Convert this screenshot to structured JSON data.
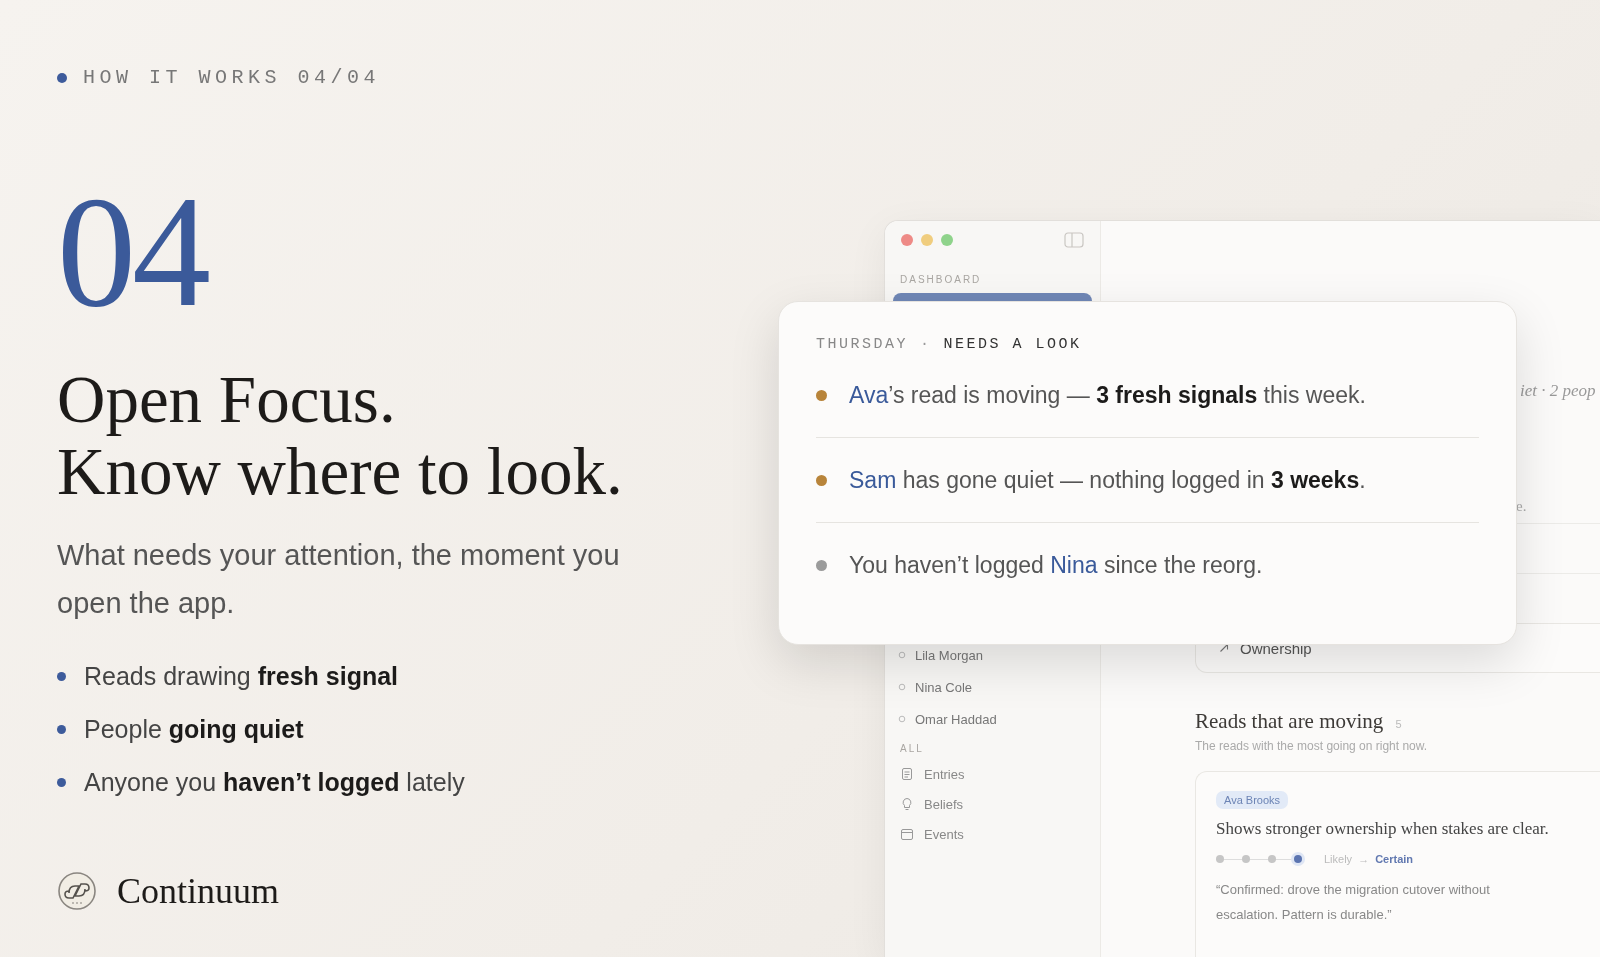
{
  "eyebrow": "HOW IT WORKS 04/04",
  "step_number": "04",
  "headline": [
    "Open Focus.",
    "Know where to look."
  ],
  "subtitle": "What needs your attention, the moment you open the app.",
  "bullets": [
    "Reads drawing **fresh signal**",
    "People **going quiet**",
    "Anyone you **haven’t logged** lately"
  ],
  "brand": "Continuum",
  "app_window": {
    "sidebar": {
      "section_label": "DASHBOARD",
      "people": [
        "Lila Morgan",
        "Nina Cole",
        "Omar Haddad"
      ],
      "all_label": "ALL",
      "links": [
        {
          "kind": "entries",
          "label": "Entries"
        },
        {
          "kind": "beliefs",
          "label": "Beliefs"
        },
        {
          "kind": "events",
          "label": "Events"
        }
      ]
    },
    "main": {
      "partial_caption": "iet · 2 peop",
      "partial_text": "e.",
      "ownership_card": "Ownership",
      "section_title": "Reads that are moving",
      "section_count": "5",
      "section_subtitle": "The reads with the most going on right now.",
      "read_card": {
        "tag": "Ava Brooks",
        "statement": "Shows stronger ownership when stakes are clear.",
        "steps": [
          {
            "selected": false
          },
          {
            "selected": false
          },
          {
            "selected": false
          },
          {
            "selected": true
          }
        ],
        "from_label": "Likely",
        "arrow": "→",
        "to_label": "Certain",
        "quote": "“Confirmed: drove the migration cutover without escalation. Pattern is durable.”"
      }
    }
  },
  "popup": {
    "day": "THURSDAY",
    "separator": "·",
    "heading": "NEEDS A LOOK",
    "items": [
      {
        "color": "#b8843a",
        "segments": [
          {
            "kind": "name",
            "text": "Ava"
          },
          {
            "kind": "plain",
            "text": "’s read is moving — "
          },
          {
            "kind": "strong",
            "text": "3 fresh signals"
          },
          {
            "kind": "plain",
            "text": " this week."
          }
        ]
      },
      {
        "color": "#b8843a",
        "segments": [
          {
            "kind": "name",
            "text": "Sam"
          },
          {
            "kind": "plain",
            "text": " has gone quiet — nothing logged in "
          },
          {
            "kind": "strong",
            "text": "3 weeks"
          },
          {
            "kind": "plain",
            "text": "."
          }
        ]
      },
      {
        "color": "#9b9b9b",
        "segments": [
          {
            "kind": "plain",
            "text": "You haven’t logged "
          },
          {
            "kind": "name",
            "text": "Nina"
          },
          {
            "kind": "plain",
            "text": " since the reorg."
          }
        ]
      }
    ]
  }
}
